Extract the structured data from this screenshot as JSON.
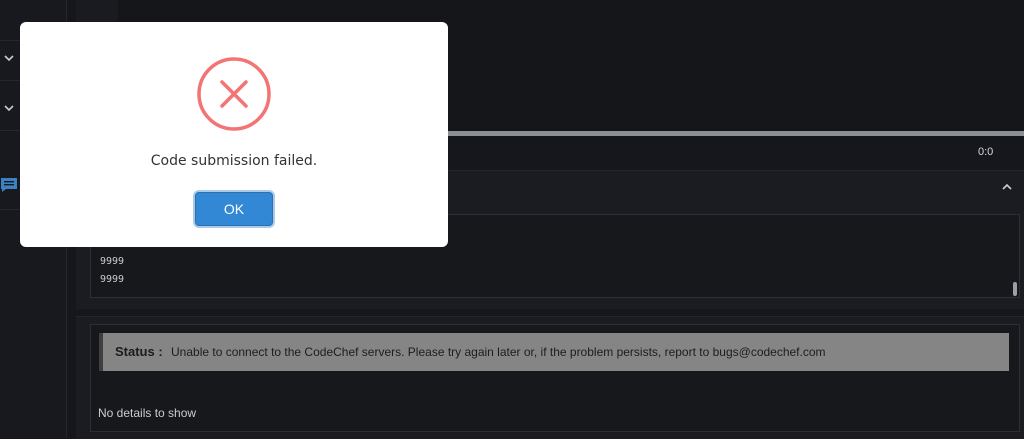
{
  "modal": {
    "message": "Code submission failed.",
    "ok_label": "OK",
    "icon": "error-x-icon",
    "icon_color": "#f27474"
  },
  "sidebar": {
    "items": [
      {
        "icon": "chevron-down-icon"
      },
      {
        "icon": "chevron-down-icon"
      },
      {
        "icon": "chat-icon",
        "color": "#3b82c4"
      }
    ]
  },
  "editor": {
    "timer": "0:0"
  },
  "io": {
    "lines": [
      "9999",
      "9999"
    ],
    "collapse_icon": "chevron-up-icon"
  },
  "result": {
    "status_label": "Status :",
    "status_message": "Unable to connect to the CodeChef servers. Please try again later or, if the problem persists, report to bugs@codechef.com",
    "details": "No details to show"
  }
}
